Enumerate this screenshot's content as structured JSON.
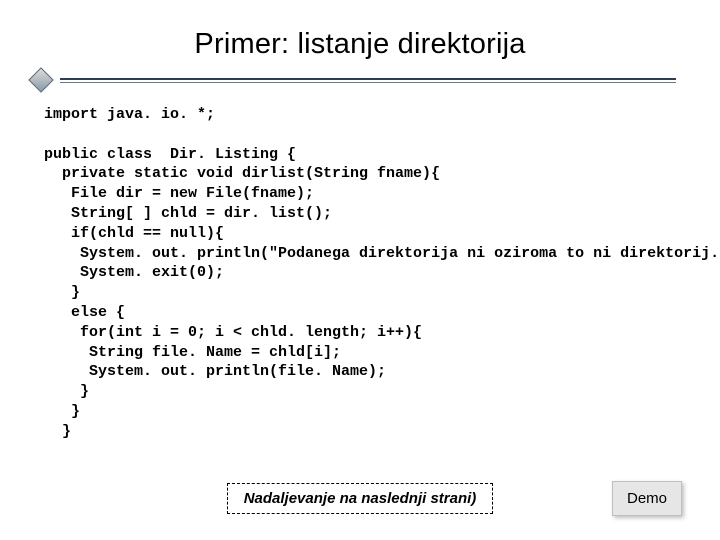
{
  "title": "Primer: listanje direktorija",
  "code_lines": [
    "import java. io. *;",
    "",
    "public class  Dir. Listing {",
    "  private static void dirlist(String fname){",
    "   File dir = new File(fname);",
    "   String[ ] chld = dir. list();",
    "   if(chld == null){",
    "    System. out. println(\"Podanega direktorija ni oziroma to ni direktorij. \");",
    "    System. exit(0);",
    "   }",
    "   else {",
    "    for(int i = 0; i < chld. length; i++){",
    "     String file. Name = chld[i];",
    "     System. out. println(file. Name);",
    "    }",
    "   }",
    "  }"
  ],
  "continuation": "Nadaljevanje na naslednji strani)",
  "demo_label": "Demo"
}
